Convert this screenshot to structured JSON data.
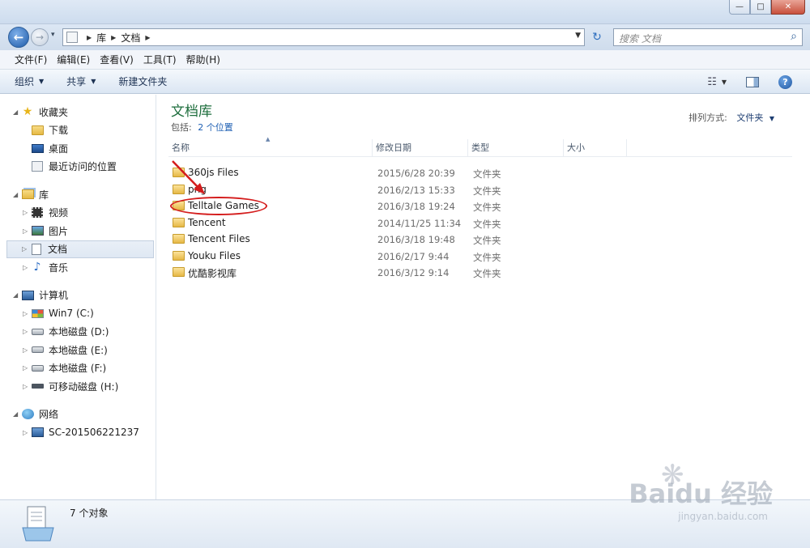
{
  "window": {
    "buttons": {
      "minimize": "—",
      "maximize": "□",
      "close": "✕"
    }
  },
  "nav": {
    "back_glyph": "←",
    "forward_glyph": "→",
    "history_glyph": "▾",
    "breadcrumb": [
      "库",
      "文档"
    ],
    "refresh_glyph": "↻",
    "search_placeholder": "搜索 文档"
  },
  "menu": [
    "文件(F)",
    "编辑(E)",
    "查看(V)",
    "工具(T)",
    "帮助(H)"
  ],
  "toolbar": {
    "organize": "组织",
    "share": "共享",
    "new_folder": "新建文件夹"
  },
  "sidebar": {
    "favorites": {
      "label": "收藏夹",
      "items": [
        "下载",
        "桌面",
        "最近访问的位置"
      ]
    },
    "libraries": {
      "label": "库",
      "items": [
        "视频",
        "图片",
        "文档",
        "音乐"
      ],
      "selected": "文档"
    },
    "computer": {
      "label": "计算机",
      "items": [
        "Win7 (C:)",
        "本地磁盘 (D:)",
        "本地磁盘 (E:)",
        "本地磁盘 (F:)",
        "可移动磁盘 (H:)"
      ]
    },
    "network": {
      "label": "网络",
      "items": [
        "SC-201506221237"
      ]
    }
  },
  "content": {
    "title": "文档库",
    "includes_label": "包括:",
    "includes_link": "2 个位置",
    "sort_label": "排列方式:",
    "sort_value": "文件夹",
    "columns": {
      "name": "名称",
      "date": "修改日期",
      "type": "类型",
      "size": "大小"
    },
    "files": [
      {
        "name": "360js Files",
        "date": "2015/6/28 20:39",
        "type": "文件夹"
      },
      {
        "name": "png",
        "date": "2016/2/13 15:33",
        "type": "文件夹"
      },
      {
        "name": "Telltale Games",
        "date": "2016/3/18 19:24",
        "type": "文件夹"
      },
      {
        "name": "Tencent",
        "date": "2014/11/25 11:34",
        "type": "文件夹"
      },
      {
        "name": "Tencent Files",
        "date": "2016/3/18 19:48",
        "type": "文件夹"
      },
      {
        "name": "Youku Files",
        "date": "2016/2/17 9:44",
        "type": "文件夹"
      },
      {
        "name": "优酷影视库",
        "date": "2016/3/12 9:14",
        "type": "文件夹"
      }
    ]
  },
  "status": {
    "count": "7 个对象"
  },
  "watermark": {
    "logo": "Baidu 经验",
    "url": "jingyan.baidu.com"
  },
  "colors": {
    "annotation": "#d41c1c",
    "library_title": "#1e6e3d",
    "link": "#1e5fb3"
  }
}
